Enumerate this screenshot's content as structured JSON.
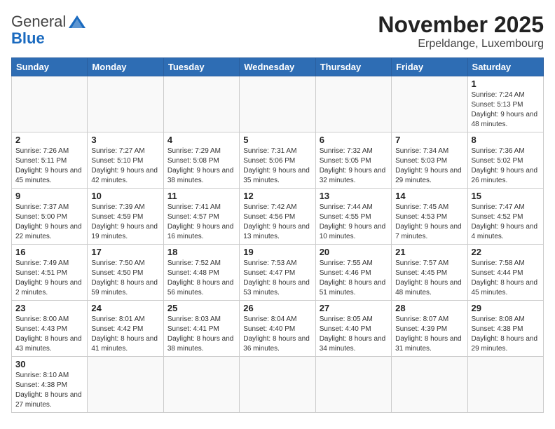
{
  "logo": {
    "general": "General",
    "blue": "Blue"
  },
  "title": {
    "month_year": "November 2025",
    "location": "Erpeldange, Luxembourg"
  },
  "weekdays": [
    "Sunday",
    "Monday",
    "Tuesday",
    "Wednesday",
    "Thursday",
    "Friday",
    "Saturday"
  ],
  "days": [
    {
      "day": "",
      "info": ""
    },
    {
      "day": "",
      "info": ""
    },
    {
      "day": "",
      "info": ""
    },
    {
      "day": "",
      "info": ""
    },
    {
      "day": "",
      "info": ""
    },
    {
      "day": "",
      "info": ""
    },
    {
      "day": "1",
      "info": "Sunrise: 7:24 AM\nSunset: 5:13 PM\nDaylight: 9 hours\nand 48 minutes."
    },
    {
      "day": "2",
      "info": "Sunrise: 7:26 AM\nSunset: 5:11 PM\nDaylight: 9 hours\nand 45 minutes."
    },
    {
      "day": "3",
      "info": "Sunrise: 7:27 AM\nSunset: 5:10 PM\nDaylight: 9 hours\nand 42 minutes."
    },
    {
      "day": "4",
      "info": "Sunrise: 7:29 AM\nSunset: 5:08 PM\nDaylight: 9 hours\nand 38 minutes."
    },
    {
      "day": "5",
      "info": "Sunrise: 7:31 AM\nSunset: 5:06 PM\nDaylight: 9 hours\nand 35 minutes."
    },
    {
      "day": "6",
      "info": "Sunrise: 7:32 AM\nSunset: 5:05 PM\nDaylight: 9 hours\nand 32 minutes."
    },
    {
      "day": "7",
      "info": "Sunrise: 7:34 AM\nSunset: 5:03 PM\nDaylight: 9 hours\nand 29 minutes."
    },
    {
      "day": "8",
      "info": "Sunrise: 7:36 AM\nSunset: 5:02 PM\nDaylight: 9 hours\nand 26 minutes."
    },
    {
      "day": "9",
      "info": "Sunrise: 7:37 AM\nSunset: 5:00 PM\nDaylight: 9 hours\nand 22 minutes."
    },
    {
      "day": "10",
      "info": "Sunrise: 7:39 AM\nSunset: 4:59 PM\nDaylight: 9 hours\nand 19 minutes."
    },
    {
      "day": "11",
      "info": "Sunrise: 7:41 AM\nSunset: 4:57 PM\nDaylight: 9 hours\nand 16 minutes."
    },
    {
      "day": "12",
      "info": "Sunrise: 7:42 AM\nSunset: 4:56 PM\nDaylight: 9 hours\nand 13 minutes."
    },
    {
      "day": "13",
      "info": "Sunrise: 7:44 AM\nSunset: 4:55 PM\nDaylight: 9 hours\nand 10 minutes."
    },
    {
      "day": "14",
      "info": "Sunrise: 7:45 AM\nSunset: 4:53 PM\nDaylight: 9 hours\nand 7 minutes."
    },
    {
      "day": "15",
      "info": "Sunrise: 7:47 AM\nSunset: 4:52 PM\nDaylight: 9 hours\nand 4 minutes."
    },
    {
      "day": "16",
      "info": "Sunrise: 7:49 AM\nSunset: 4:51 PM\nDaylight: 9 hours\nand 2 minutes."
    },
    {
      "day": "17",
      "info": "Sunrise: 7:50 AM\nSunset: 4:50 PM\nDaylight: 8 hours\nand 59 minutes."
    },
    {
      "day": "18",
      "info": "Sunrise: 7:52 AM\nSunset: 4:48 PM\nDaylight: 8 hours\nand 56 minutes."
    },
    {
      "day": "19",
      "info": "Sunrise: 7:53 AM\nSunset: 4:47 PM\nDaylight: 8 hours\nand 53 minutes."
    },
    {
      "day": "20",
      "info": "Sunrise: 7:55 AM\nSunset: 4:46 PM\nDaylight: 8 hours\nand 51 minutes."
    },
    {
      "day": "21",
      "info": "Sunrise: 7:57 AM\nSunset: 4:45 PM\nDaylight: 8 hours\nand 48 minutes."
    },
    {
      "day": "22",
      "info": "Sunrise: 7:58 AM\nSunset: 4:44 PM\nDaylight: 8 hours\nand 45 minutes."
    },
    {
      "day": "23",
      "info": "Sunrise: 8:00 AM\nSunset: 4:43 PM\nDaylight: 8 hours\nand 43 minutes."
    },
    {
      "day": "24",
      "info": "Sunrise: 8:01 AM\nSunset: 4:42 PM\nDaylight: 8 hours\nand 41 minutes."
    },
    {
      "day": "25",
      "info": "Sunrise: 8:03 AM\nSunset: 4:41 PM\nDaylight: 8 hours\nand 38 minutes."
    },
    {
      "day": "26",
      "info": "Sunrise: 8:04 AM\nSunset: 4:40 PM\nDaylight: 8 hours\nand 36 minutes."
    },
    {
      "day": "27",
      "info": "Sunrise: 8:05 AM\nSunset: 4:40 PM\nDaylight: 8 hours\nand 34 minutes."
    },
    {
      "day": "28",
      "info": "Sunrise: 8:07 AM\nSunset: 4:39 PM\nDaylight: 8 hours\nand 31 minutes."
    },
    {
      "day": "29",
      "info": "Sunrise: 8:08 AM\nSunset: 4:38 PM\nDaylight: 8 hours\nand 29 minutes."
    },
    {
      "day": "30",
      "info": "Sunrise: 8:10 AM\nSunset: 4:38 PM\nDaylight: 8 hours\nand 27 minutes."
    },
    {
      "day": "",
      "info": ""
    },
    {
      "day": "",
      "info": ""
    },
    {
      "day": "",
      "info": ""
    },
    {
      "day": "",
      "info": ""
    },
    {
      "day": "",
      "info": ""
    },
    {
      "day": "",
      "info": ""
    }
  ]
}
